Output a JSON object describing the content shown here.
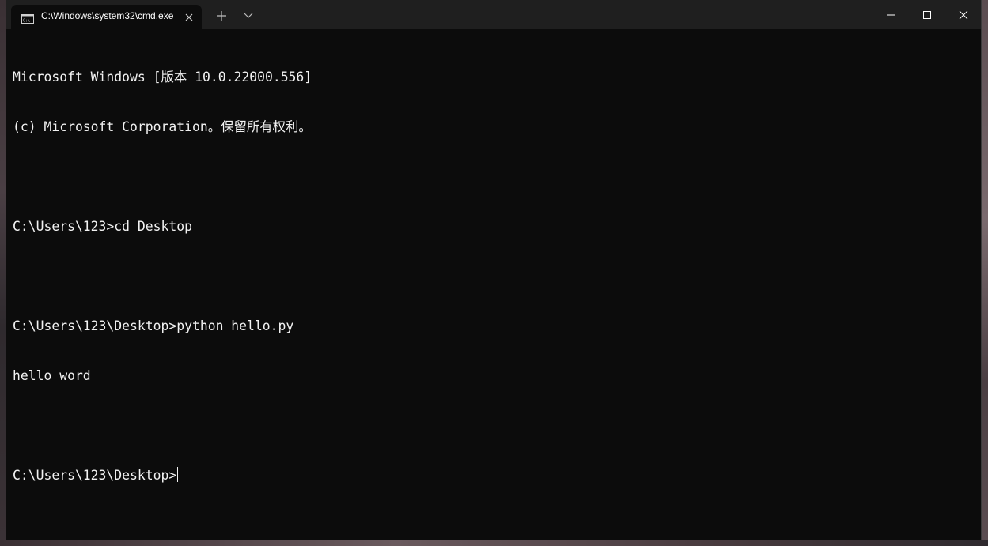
{
  "window": {
    "tab_title": "C:\\Windows\\system32\\cmd.exe",
    "tab_icon": "cmd-icon",
    "tab_close_icon": "close-icon",
    "new_tab_icon": "plus-icon",
    "dropdown_icon": "chevron-down-icon",
    "minimize_icon": "minimize-icon",
    "maximize_icon": "maximize-icon",
    "close_icon": "close-icon"
  },
  "console": {
    "lines": [
      "Microsoft Windows [版本 10.0.22000.556]",
      "(c) Microsoft Corporation。保留所有权利。",
      "",
      "C:\\Users\\123>cd Desktop",
      "",
      "C:\\Users\\123\\Desktop>python hello.py",
      "hello word",
      "",
      "C:\\Users\\123\\Desktop>"
    ]
  },
  "colors": {
    "background": "#0c0c0c",
    "titlebar": "#1f1f1f",
    "text": "#f2f2f2"
  }
}
